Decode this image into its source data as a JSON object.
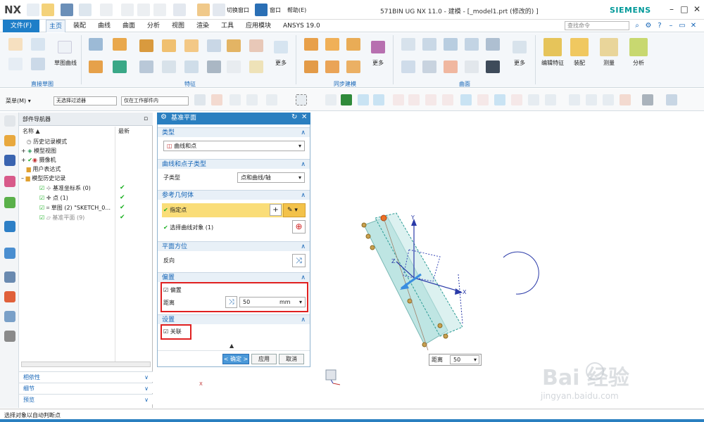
{
  "titlebar": {
    "logo": "NX",
    "switch_window": "切换窗口",
    "window_menu": "窗口",
    "help_menu": "帮助(E)",
    "title": "571BIN UG NX 11.0 - 建模 - [_model1.prt  (修改的) ]",
    "brand": "SIEMENS"
  },
  "ribbon": {
    "file_tab": "文件(F)",
    "tabs": [
      "主页",
      "装配",
      "曲线",
      "曲面",
      "分析",
      "视图",
      "渲染",
      "工具",
      "应用模块",
      "ANSYS 19.0"
    ],
    "command_search_placeholder": "查找命令",
    "groups": [
      "直接草图",
      "特征",
      "同步建模",
      "曲面"
    ],
    "labels": {
      "sketch_curve": "草图曲线",
      "more": "更多",
      "edit_feature": "编辑特征",
      "assembly": "装配",
      "measure": "测量",
      "analysis": "分析"
    }
  },
  "toolbar": {
    "menu": "菜单(M)",
    "filter": "无选择过滤器",
    "scope": "仅在工作部件内"
  },
  "navigator": {
    "title": "部件导航器",
    "col_name": "名称",
    "col_latest": "最新",
    "rows": [
      {
        "label": "历史记录模式",
        "check": ""
      },
      {
        "label": "模型视图",
        "check": ""
      },
      {
        "label": "摄像机",
        "check": ""
      },
      {
        "label": "用户表达式",
        "check": ""
      },
      {
        "label": "模型历史记录",
        "check": ""
      },
      {
        "label": "基准坐标系 (0)",
        "check": "✔"
      },
      {
        "label": "点 (1)",
        "check": "✔"
      },
      {
        "label": "草图 (2) \"SKETCH_0...",
        "check": "✔"
      },
      {
        "label": "基准平面 (9)",
        "check": "✔"
      }
    ],
    "bottom_panels": [
      "相依性",
      "细节",
      "预览"
    ]
  },
  "dialog": {
    "title": "基准平面",
    "sec_type": "类型",
    "type_value": "曲线和点",
    "sec_subtype": "曲线和点子类型",
    "subtype_label": "子类型",
    "subtype_value": "点和曲线/轴",
    "sec_ref": "参考几何体",
    "specify_point": "指定点",
    "select_curve": "选择曲线对象 (1)",
    "sec_orient": "平面方位",
    "reverse": "反向",
    "sec_offset": "偏置",
    "offset_check": "偏置",
    "distance_label": "距离",
    "distance_value": "50",
    "distance_unit": "mm",
    "sec_settings": "设置",
    "associative": "关联",
    "ok": "< 确定 >",
    "apply": "应用",
    "cancel": "取消"
  },
  "viewport": {
    "float_label": "距离",
    "float_value": "50",
    "axis_x": "X",
    "axis_y": "Y",
    "axis_z": "Z"
  },
  "status": {
    "text": "选择对象以自动判断点"
  },
  "watermark": {
    "brand": "Bai 经验",
    "url": "jingyan.baidu.com"
  },
  "colors": {
    "accent": "#2a7fc0",
    "highlight": "#fadd78",
    "red": "#e02020",
    "plane_fill": "#a8dcd9",
    "check_green": "#1bb022"
  }
}
